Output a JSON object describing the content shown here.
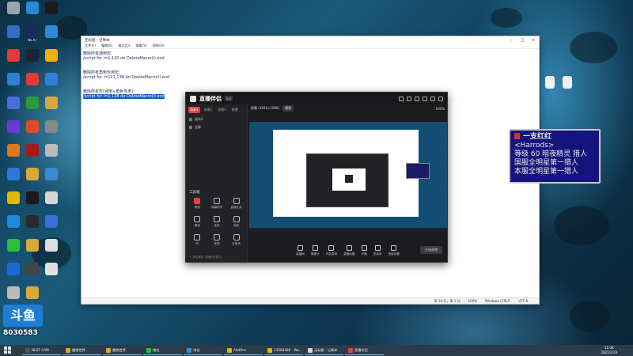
{
  "desktop": {
    "icons_left": [
      {
        "label": "",
        "color": "#9aa4ad"
      },
      {
        "label": "",
        "color": "#2a88d8"
      },
      {
        "label": "",
        "color": "#1a1a1a"
      },
      {
        "label": "",
        "color": "#2d6fc9"
      },
      {
        "label": "NEXT",
        "color": "#1b2b5a"
      },
      {
        "label": "",
        "color": "#2a8bdc"
      },
      {
        "label": "",
        "color": "#e03a3a"
      },
      {
        "label": "",
        "color": "#1c2333"
      },
      {
        "label": "",
        "color": "#f0b400"
      },
      {
        "label": "",
        "color": "#2f7fd6"
      },
      {
        "label": "",
        "color": "#e03a3a"
      },
      {
        "label": "",
        "color": "#2f7fd6"
      },
      {
        "label": "",
        "color": "#4a6fdc"
      },
      {
        "label": "",
        "color": "#2a9a3a"
      },
      {
        "label": "",
        "color": "#d6a93a"
      },
      {
        "label": "",
        "color": "#6a3ad6"
      },
      {
        "label": "",
        "color": "#e04a2a"
      },
      {
        "label": "",
        "color": "#888888"
      },
      {
        "label": "",
        "color": "#e07a1a"
      },
      {
        "label": "",
        "color": "#a61a1a"
      },
      {
        "label": "",
        "color": "#bbbbbb"
      },
      {
        "label": "",
        "color": "#2a7adb"
      },
      {
        "label": "",
        "color": "#d6a93a"
      },
      {
        "label": "",
        "color": "#3a8bd6"
      },
      {
        "label": "",
        "color": "#e0b800"
      },
      {
        "label": "",
        "color": "#1a1a1a"
      },
      {
        "label": "",
        "color": "#d6d6d6"
      },
      {
        "label": "",
        "color": "#1a8be0"
      },
      {
        "label": "",
        "color": "#2a2a2a"
      },
      {
        "label": "",
        "color": "#3a6fdc"
      },
      {
        "label": "",
        "color": "#2ac03a"
      },
      {
        "label": "",
        "color": "#d6a93a"
      },
      {
        "label": "",
        "color": "#dddddd"
      },
      {
        "label": "",
        "color": "#1a6ad6"
      },
      {
        "label": "",
        "color": "#444444"
      },
      {
        "label": "",
        "color": "#e0e0e0"
      },
      {
        "label": "",
        "color": "#bbbbbb"
      },
      {
        "label": "",
        "color": "#d6a93a"
      }
    ],
    "icons_right": [
      {
        "label": "",
        "color": "#f0f0f0"
      },
      {
        "label": "",
        "color": "#f0f0f0"
      }
    ]
  },
  "notepad": {
    "title": "无标题 - 记事本",
    "menu": [
      "文件(F)",
      "编辑(E)",
      "格式(O)",
      "查看(V)",
      "帮助(H)"
    ],
    "lines": [
      {
        "text": "删除所有通用宏:",
        "selected": false
      },
      {
        "text": "/script for i=1,120 do DeleteMacro(i) end",
        "selected": false
      },
      {
        "text": "",
        "selected": false
      },
      {
        "text": "",
        "selected": false
      },
      {
        "text": "删除所有角色专用宏:",
        "selected": false
      },
      {
        "text": "/script for i=121,138 do DeleteMacro(i) end",
        "selected": false
      },
      {
        "text": "",
        "selected": false
      },
      {
        "text": "",
        "selected": false
      },
      {
        "text": "删除所有宏(通用+角色专用):",
        "selected": false
      },
      {
        "text": "/script for i=1,138 do DeleteMacro(i) end",
        "selected": true
      }
    ],
    "status": [
      "第 10 行，第 1 列",
      "100%",
      "Windows (CRLF)",
      "UTF-8"
    ]
  },
  "streamer_app": {
    "name": "直播伴侣",
    "version": "3.0",
    "tabs": [
      "场景1",
      "场景2",
      "场景3",
      "直播"
    ],
    "scenes": [
      "画布1",
      "全屏"
    ],
    "tools_title": "工具箱",
    "tools": [
      {
        "label": "美颜",
        "red": true
      },
      {
        "label": "弹幕助手",
        "red": false
      },
      {
        "label": "直播任务",
        "red": false
      },
      {
        "label": "福袋",
        "red": false
      },
      {
        "label": "连麦",
        "red": false
      },
      {
        "label": "贴纸",
        "red": false
      },
      {
        "label": "PK",
        "red": false
      },
      {
        "label": "视频",
        "red": false
      },
      {
        "label": "全景声",
        "red": false
      }
    ],
    "left_footer": "+ 添加素材 (摄像头/窗口)",
    "main_bar": {
      "title": "屏幕 (1920×1080)",
      "badge": "横屏",
      "zoom": "100%"
    },
    "controls": [
      "直播间",
      "摄像头",
      "开启录制",
      "直播设置",
      "开播",
      "麦克风",
      "音频设置"
    ],
    "start_label": "开始直播"
  },
  "game_card": {
    "name": "一支红红",
    "guild": "<Harrods>",
    "level_line": "等级 60 暗夜精灵 猎人",
    "title_line1": "国服全明星第一猎人",
    "title_line2": "本服全明星第一猎人"
  },
  "badge": {
    "logo": "斗鱼",
    "room": "8030583"
  },
  "taskbar": {
    "items": [
      {
        "label": "NEST CAM",
        "color": "#555555"
      },
      {
        "label": "魔兽世界",
        "color": "#d6a93a"
      },
      {
        "label": "魔兽世界",
        "color": "#d6a93a"
      },
      {
        "label": "微信",
        "color": "#2ac03a"
      },
      {
        "label": "浏览",
        "color": "#3a8bd6"
      },
      {
        "label": "AddOns",
        "color": "#e0b800"
      },
      {
        "label": "13589480 - Wa...",
        "color": "#e0b800"
      },
      {
        "label": "无标题 - 记事本",
        "color": "#d6d6d6"
      },
      {
        "label": "直播伴侣",
        "color": "#e94040"
      }
    ],
    "time": "11:08",
    "date": "2021/2/19"
  }
}
